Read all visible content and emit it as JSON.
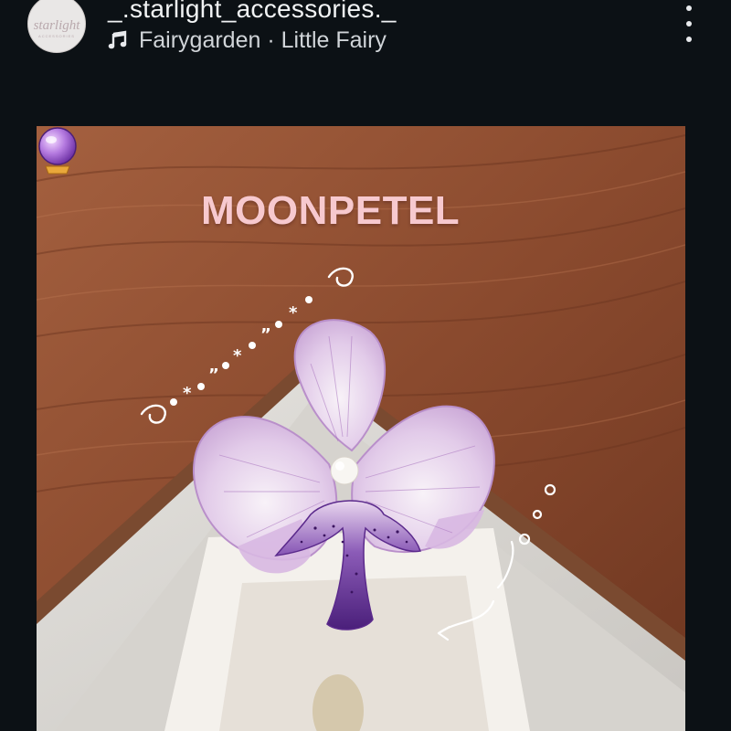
{
  "post": {
    "username": "_.starlight_accessories._",
    "avatar_text": "starlight",
    "avatar_subtext": "ACCESSORIES",
    "music": "Fairygarden · Little Fairy",
    "more_icon": "more-vertical-icon",
    "music_icon": "music-note-icon"
  },
  "photo": {
    "caption": "MOONPETEL",
    "caption_emoji": "crystal-ball-icon",
    "caption_color": "#f7c9cf",
    "description": "Lilac orchid hair clip with pearl center on a wooden table"
  },
  "colors": {
    "background": "#0c1115",
    "wood": "#8a4a2e",
    "orchid": "#d8b8e2",
    "lip": "#5b2a8c"
  }
}
